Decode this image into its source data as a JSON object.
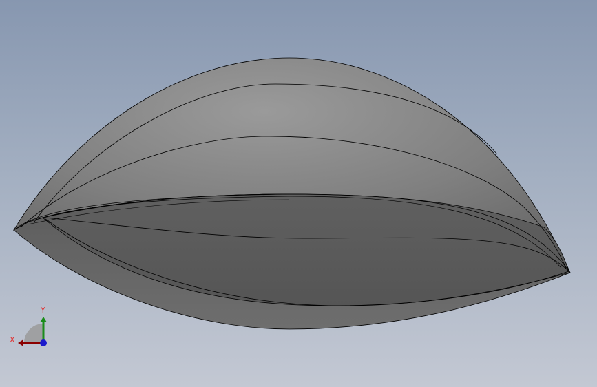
{
  "viewport": {
    "colors": {
      "background_top": "#8797b0",
      "background_bottom": "#c3c8d3",
      "shell_outer": "#8a8a8a",
      "shell_inner": "#5a5a5a",
      "edge": "#000000"
    }
  },
  "triad": {
    "x_label": "X",
    "y_label": "Y",
    "colors": {
      "x_axis": "#8b0000",
      "y_axis": "#1a8c1a",
      "z_axis": "#1a1acc",
      "labels": "#e03030"
    }
  }
}
